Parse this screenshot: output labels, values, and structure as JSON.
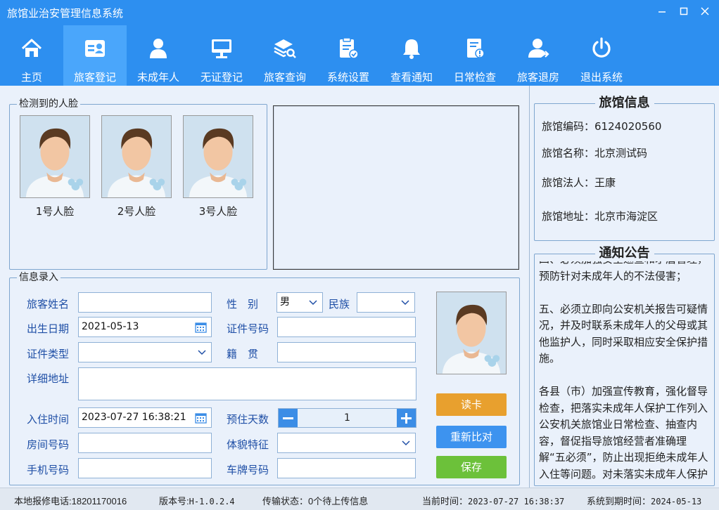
{
  "app": {
    "title": "旅馆业治安管理信息系统",
    "accent": "#2d8ff0"
  },
  "nav": [
    {
      "label": "主页",
      "icon": "home-icon"
    },
    {
      "label": "旅客登记",
      "icon": "id-card-icon",
      "active": true
    },
    {
      "label": "未成年人",
      "icon": "person-icon"
    },
    {
      "label": "无证登记",
      "icon": "monitor-icon"
    },
    {
      "label": "旅客查询",
      "icon": "layers-search-icon"
    },
    {
      "label": "系统设置",
      "icon": "settings-doc-icon"
    },
    {
      "label": "查看通知",
      "icon": "bell-icon"
    },
    {
      "label": "日常检查",
      "icon": "inspection-icon"
    },
    {
      "label": "旅客退房",
      "icon": "checkout-person-icon"
    },
    {
      "label": "退出系统",
      "icon": "power-icon"
    }
  ],
  "faces": {
    "title": "检测到的人脸",
    "items": [
      "1号人脸",
      "2号人脸",
      "3号人脸"
    ]
  },
  "form": {
    "title": "信息录入",
    "name_label": "旅客姓名",
    "name_value": "",
    "gender_label": "性　别",
    "gender_value": "男",
    "ethnic_label": "民族",
    "ethnic_value": "",
    "birth_label": "出生日期",
    "birth_value": "2021-05-13",
    "idno_label": "证件号码",
    "idno_value": "",
    "idtype_label": "证件类型",
    "idtype_value": "",
    "native_label": "籍　贯",
    "native_value": "",
    "address_label": "详细地址",
    "address_value": "",
    "checkin_label": "入住时间",
    "checkin_value": "2023-07-27 16:38:21",
    "days_label": "预住天数",
    "days_value": "1",
    "room_label": "房间号码",
    "room_value": "",
    "feature_label": "体貌特征",
    "feature_value": "",
    "phone_label": "手机号码",
    "phone_value": "",
    "plate_label": "车牌号码",
    "plate_value": ""
  },
  "buttons": {
    "read_card": "读卡",
    "rematch": "重新比对",
    "save": "保存",
    "read_color": "#e8a02e",
    "rematch_color": "#3d93ef",
    "save_color": "#6cc13a"
  },
  "hotel": {
    "title": "旅馆信息",
    "code": "旅馆编码：6124020560",
    "name": "旅馆名称：北京测试码",
    "legal": "旅馆法人：王康",
    "address": "旅馆地址：北京市海淀区"
  },
  "notice": {
    "title": "通知公告",
    "paragraphs": [
      "四、必须加强安全巡查和矛盾管理，预防针对未成年人的不法侵害；",
      "五、必须立即向公安机关报告可疑情况，并及时联系未成年人的父母或其他监护人，同时采取相应安全保护措施。",
      "各县（市）加强宣传教育，强化督导检查，把落实未成年人保护工作列入公安机关旅馆业日常检查、抽查内容，督促指导旅馆经营者准确理解“五必须”，防止出现拒绝未成年人入住等问题。对未落实未成年人保护法定义务的，依照相关法"
    ]
  },
  "status": {
    "phone": "本地报修电话:18201170016",
    "version_label": "版本号:",
    "version": "H-1.0.2.4",
    "upload": "传输状态：0个待上传信息",
    "now_label": "当前时间：",
    "now": "2023-07-27 16:38:37",
    "expire_label": "系统到期时间：",
    "expire": "2024-05-13"
  }
}
